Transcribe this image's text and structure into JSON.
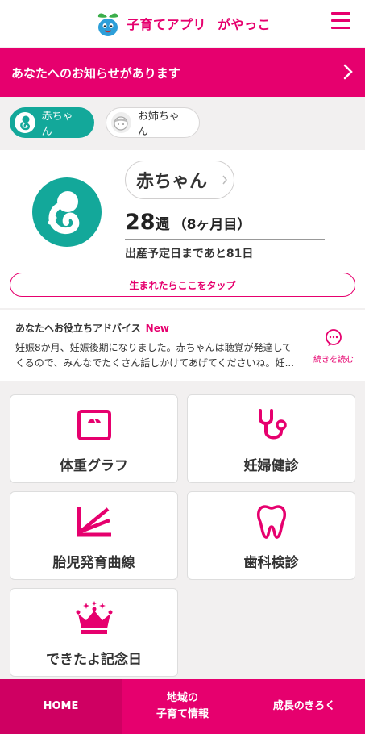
{
  "header": {
    "app_name": "子育てアプリ",
    "app_name_suffix": "がやっこ",
    "brand_color": "#e6006e"
  },
  "notice": {
    "text": "あなたへのお知らせがあります"
  },
  "children_tabs": [
    {
      "label": "赤ちゃん",
      "active": true
    },
    {
      "label": "お姉ちゃん",
      "active": false
    }
  ],
  "profile": {
    "name": "赤ちゃん",
    "weeks": "28",
    "weeks_unit": "週",
    "months": "（8ヶ月目）",
    "due_text": "出産予定日まであと81日",
    "born_button": "生まれたらここをタップ",
    "accent_color": "#13a89a"
  },
  "advice": {
    "title": "あなたへお役立ちアドバイス",
    "badge": "New",
    "body": "妊娠8か月、妊娠後期になりました。赤ちゃんは聴覚が発達してくるので、みんなでたくさん話しかけてあげてくださいね。妊...",
    "read_more": "続きを読む"
  },
  "menu": [
    {
      "label": "体重グラフ",
      "icon": "scale-icon"
    },
    {
      "label": "妊婦健診",
      "icon": "stethoscope-icon"
    },
    {
      "label": "胎児発育曲線",
      "icon": "growth-curve-icon"
    },
    {
      "label": "歯科検診",
      "icon": "tooth-icon"
    },
    {
      "label": "できたよ記念日",
      "icon": "crown-icon"
    }
  ],
  "bottom_nav": {
    "home": "HOME",
    "local_line1": "地域の",
    "local_line2": "子育て情報",
    "growth": "成長のきろく"
  }
}
